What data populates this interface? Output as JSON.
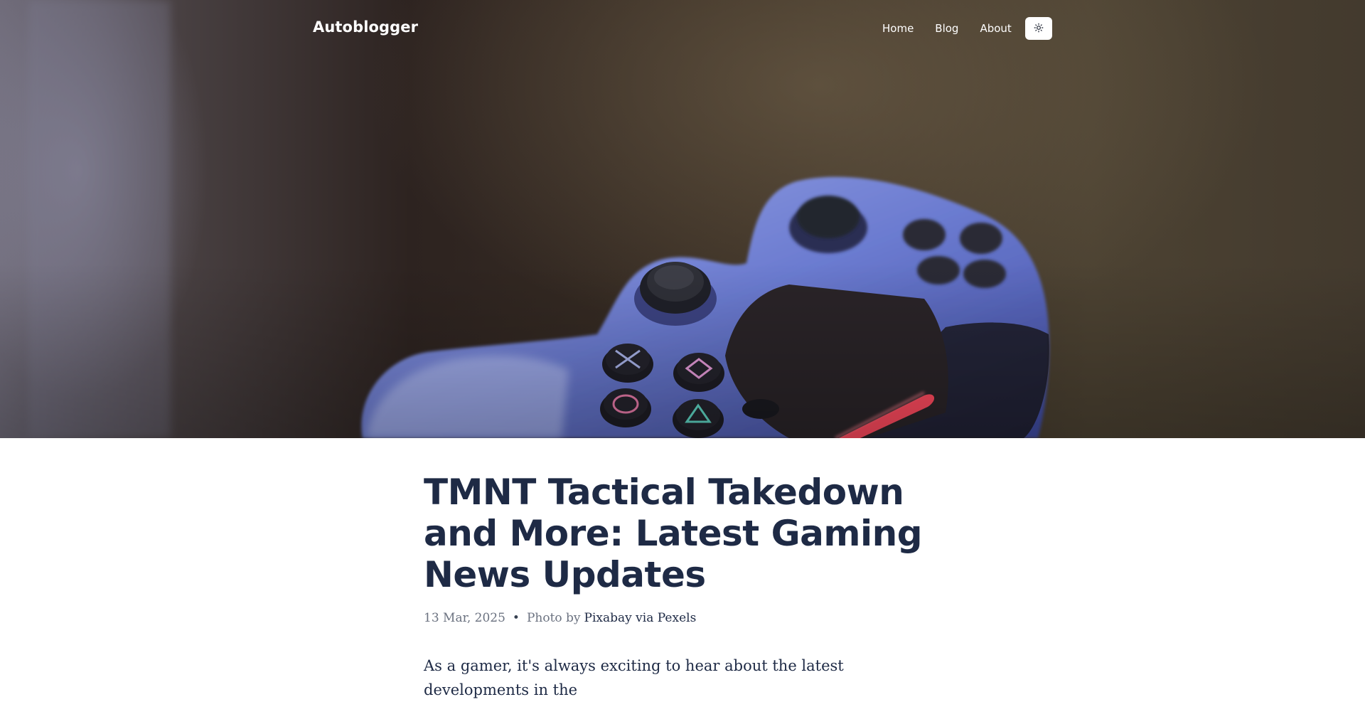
{
  "site": {
    "brand": "Autoblogger"
  },
  "nav": {
    "items": [
      {
        "label": "Home"
      },
      {
        "label": "Blog"
      },
      {
        "label": "About"
      }
    ],
    "theme_toggle_icon": "sun-icon"
  },
  "hero": {
    "image_subject": "game-controller"
  },
  "article": {
    "title": "TMNT Tactical Takedown and More: Latest Gaming News Updates",
    "date": "13 Mar, 2025",
    "separator": "•",
    "photo_prefix": "Photo by",
    "photo_credit": "Pixabay via Pexels",
    "intro": "As a gamer, it's always exciting to hear about the latest developments in the"
  },
  "colors": {
    "title": "#1e2a45",
    "meta": "#6b7280",
    "nav_text": "#ffffff",
    "toggle_bg": "#ffffff"
  }
}
